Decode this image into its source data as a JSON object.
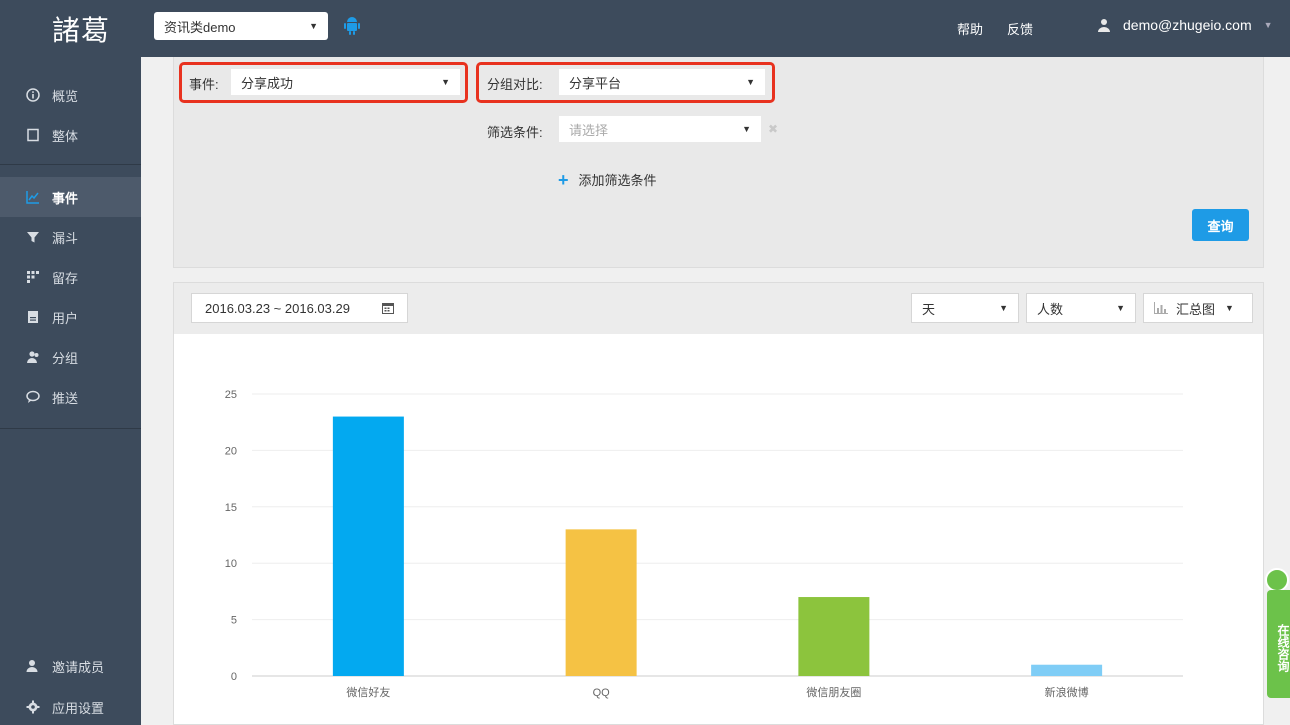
{
  "topbar": {
    "logo": "諸葛",
    "app_select": "资讯类demo",
    "help": "帮助",
    "feedback": "反馈",
    "user_email": "demo@zhugeio.com"
  },
  "sidebar": {
    "items": [
      {
        "label": "概览",
        "icon": "info-circle-icon"
      },
      {
        "label": "整体",
        "icon": "square-icon"
      },
      {
        "label": "事件",
        "icon": "line-chart-icon",
        "active": true
      },
      {
        "label": "漏斗",
        "icon": "funnel-icon"
      },
      {
        "label": "留存",
        "icon": "grid-dots-icon"
      },
      {
        "label": "用户",
        "icon": "document-icon"
      },
      {
        "label": "分组",
        "icon": "users-icon"
      },
      {
        "label": "推送",
        "icon": "chat-icon"
      }
    ],
    "bottom": [
      {
        "label": "邀请成员",
        "icon": "user-add-icon"
      },
      {
        "label": "应用设置",
        "icon": "gear-icon"
      }
    ]
  },
  "filters": {
    "event_label": "事件:",
    "event_value": "分享成功",
    "group_label": "分组对比:",
    "group_value": "分享平台",
    "filter_label": "筛选条件:",
    "filter_placeholder": "请选择",
    "add_filter": "添加筛选条件",
    "query_button": "查询"
  },
  "toolbar": {
    "date_range": "2016.03.23 ~ 2016.03.29",
    "granularity": "天",
    "metric": "人数",
    "chart_type": "汇总图"
  },
  "consult": {
    "label": "在线咨询"
  },
  "colors": {
    "sidebar_bg": "#3d4b5c",
    "accent": "#1e9be6",
    "highlight_box": "#e8321f"
  },
  "chart_data": {
    "type": "bar",
    "categories": [
      "微信好友",
      "QQ",
      "微信朋友圈",
      "新浪微博"
    ],
    "values": [
      23,
      13,
      7,
      1
    ],
    "colors": [
      "#03a9f0",
      "#f5c244",
      "#8cc43d",
      "#7fcdf6"
    ],
    "yticks": [
      0,
      5,
      10,
      15,
      20,
      25
    ],
    "ylim": [
      0,
      25
    ],
    "grid": true
  }
}
